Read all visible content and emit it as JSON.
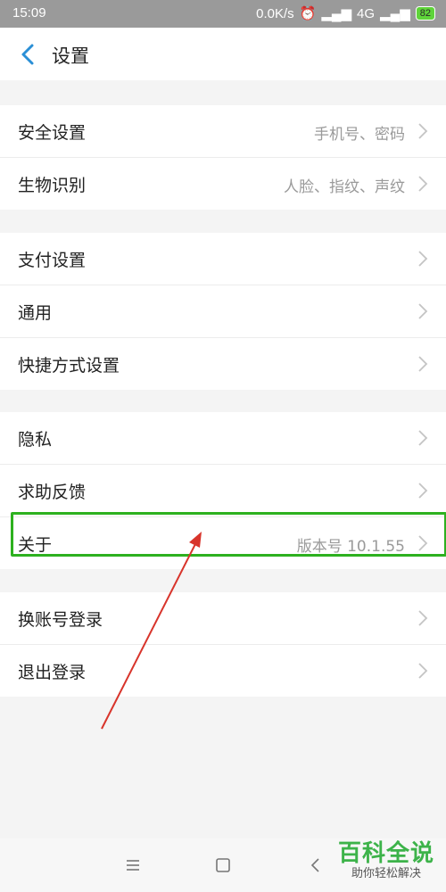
{
  "status_bar": {
    "time": "15:09",
    "network_speed": "0.0K/s",
    "network_type": "4G",
    "battery": "82"
  },
  "header": {
    "title": "设置"
  },
  "groups": [
    {
      "items": [
        {
          "label": "安全设置",
          "value": "手机号、密码"
        },
        {
          "label": "生物识别",
          "value": "人脸、指纹、声纹"
        }
      ]
    },
    {
      "items": [
        {
          "label": "支付设置",
          "value": ""
        },
        {
          "label": "通用",
          "value": ""
        },
        {
          "label": "快捷方式设置",
          "value": ""
        }
      ]
    },
    {
      "items": [
        {
          "label": "隐私",
          "value": ""
        },
        {
          "label": "求助反馈",
          "value": ""
        },
        {
          "label": "关于",
          "value": "版本号 10.1.55"
        }
      ]
    },
    {
      "items": [
        {
          "label": "换账号登录",
          "value": ""
        },
        {
          "label": "退出登录",
          "value": ""
        }
      ]
    }
  ],
  "watermark": {
    "title": "百科全说",
    "subtitle": "助你轻松解决"
  },
  "colors": {
    "highlight": "#2db11f",
    "arrow": "#d8342b",
    "back_icon": "#2a8fd6",
    "chevron": "#c4c4c4",
    "status_bar": "#9a9a9a"
  }
}
